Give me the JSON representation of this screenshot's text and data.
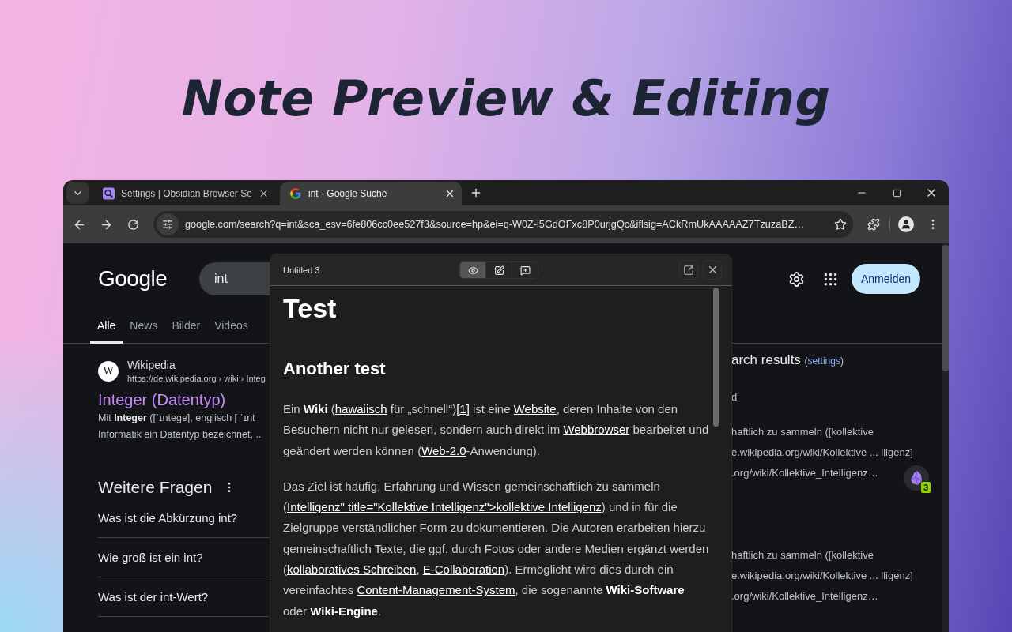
{
  "headline": "Note Preview & Editing",
  "browser": {
    "tabs": [
      {
        "title": "Settings | Obsidian Browser Se",
        "selected": false
      },
      {
        "title": "int - Google Suche",
        "selected": true
      }
    ],
    "url": "google.com/search?q=int&sca_esv=6fe806cc0ee527f3&source=hp&ei=q-W0Z-i5GdOFxc8P0urjgQc&iflsig=ACkRmUkAAAAAZ7TzuzaBZ…"
  },
  "google": {
    "logo": "Google",
    "query": "int",
    "signin": "Anmelden",
    "nav": [
      {
        "label": "Alle",
        "selected": true
      },
      {
        "label": "News",
        "selected": false
      },
      {
        "label": "Bilder",
        "selected": false
      },
      {
        "label": "Videos",
        "selected": false
      }
    ],
    "result": {
      "favicon_letter": "W",
      "site": "Wikipedia",
      "breadcrumb": "https://de.wikipedia.org › wiki › Integ",
      "title": "Integer (Datentyp)",
      "snippet": [
        "Mit **Integer** ([ˈɪntegɐ], englisch [ ˈɪnt",
        "Informatik ein Datentyp bezeichnet, .."
      ]
    },
    "questions_title": "Weitere Fragen",
    "questions": [
      "Was ist die Abkürzung int?",
      "Wie groß ist ein int?",
      "Was ist der int-Wert?"
    ],
    "side": {
      "heading": [
        {
          "kind": "text",
          "text": "arch results"
        },
        {
          "kind": "small",
          "text": "("
        },
        {
          "kind": "link",
          "text": "settings"
        },
        {
          "kind": "small",
          "text": ")"
        }
      ],
      "blocks": [
        [
          "d"
        ],
        [
          "haftlich zu sammeln ([kollektive",
          "e.wikipedia.org/wiki/Kollektive ... lligenz]",
          ".org/wiki/Kollektive_Intelligenz…"
        ],
        [
          "haftlich zu sammeln ([kollektive",
          "e.wikipedia.org/wiki/Kollektive ... lligenz]",
          ".org/wiki/Kollektive_Intelligenz…"
        ]
      ]
    },
    "extension_badge": "3"
  },
  "note": {
    "title": "Untitled 3",
    "modes": [
      {
        "kind": "preview",
        "selected": true
      },
      {
        "kind": "edit",
        "selected": false
      },
      {
        "kind": "comment",
        "selected": false
      }
    ],
    "blocks": [
      {
        "kind": "h1",
        "text": "Test"
      },
      {
        "kind": "h2",
        "text": "Another test"
      },
      {
        "kind": "p",
        "segments": [
          {
            "kind": "text",
            "text": "Ein "
          },
          {
            "kind": "bold",
            "text": "Wiki"
          },
          {
            "kind": "text",
            "text": " ("
          },
          {
            "kind": "link",
            "text": "hawaiisch"
          },
          {
            "kind": "text",
            "text": " für „schnell“)"
          },
          {
            "kind": "link",
            "text": "[1]"
          },
          {
            "kind": "text",
            "text": " ist eine "
          },
          {
            "kind": "link",
            "text": "Website"
          },
          {
            "kind": "text",
            "text": ", deren Inhalte von den Besuchern nicht nur gelesen, sondern auch direkt im "
          },
          {
            "kind": "link",
            "text": "Webbrowser"
          },
          {
            "kind": "text",
            "text": " bearbeitet und geändert werden können ("
          },
          {
            "kind": "link",
            "text": "Web-2.0"
          },
          {
            "kind": "text",
            "text": "-Anwendung)."
          }
        ]
      },
      {
        "kind": "p",
        "segments": [
          {
            "kind": "text",
            "text": "Das Ziel ist häufig, Erfahrung und Wissen gemeinschaftlich zu sammeln ("
          },
          {
            "kind": "link",
            "text": "Intelligenz\" title=\"Kollektive Intelligenz\">kollektive Intelligenz"
          },
          {
            "kind": "text",
            "text": ") und in für die Zielgruppe verständlicher Form zu dokumentieren. Die Autoren erarbeiten hierzu gemeinschaftlich Texte, die ggf. durch Fotos oder andere Medien ergänzt werden ("
          },
          {
            "kind": "link",
            "text": "kollaboratives Schreiben"
          },
          {
            "kind": "text",
            "text": ", "
          },
          {
            "kind": "link",
            "text": "E-Collaboration"
          },
          {
            "kind": "text",
            "text": "). Ermöglicht wird dies durch ein vereinfachtes "
          },
          {
            "kind": "link",
            "text": "Content-Management-System"
          },
          {
            "kind": "text",
            "text": ", die sogenannte "
          },
          {
            "kind": "bold",
            "text": "Wiki-Software"
          },
          {
            "kind": "text",
            "text": " oder "
          },
          {
            "kind": "bold",
            "text": "Wiki-Engine"
          },
          {
            "kind": "text",
            "text": "."
          }
        ]
      }
    ]
  }
}
